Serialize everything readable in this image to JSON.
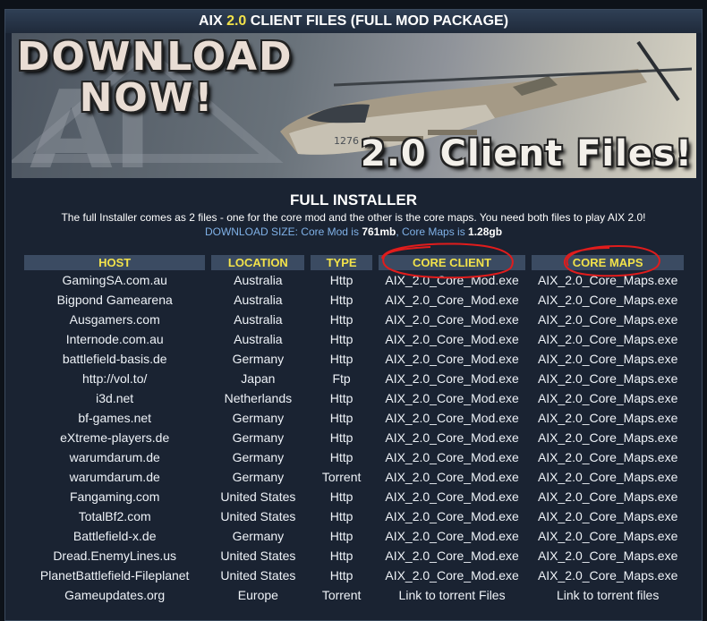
{
  "title": {
    "prefix": "AIX ",
    "version": "2.0",
    "suffix": " CLIENT FILES (FULL MOD PACKAGE)"
  },
  "banner": {
    "line1": "DOWNLOAD",
    "line2": "NOW!",
    "tagline": "2.0 Client Files!",
    "logo_text": "AI",
    "heli_number": "1276"
  },
  "installer": {
    "heading": "FULL INSTALLER",
    "description": "The full Installer comes as 2 files - one for the core mod and the other is the core maps. You need both files to play AIX 2.0!",
    "size_prefix": "DOWNLOAD SIZE: Core Mod is ",
    "core_mod_size": "761mb",
    "size_mid": ", Core Maps is ",
    "core_maps_size": "1.28gb"
  },
  "table": {
    "headers": [
      "HOST",
      "LOCATION",
      "TYPE",
      "CORE CLIENT",
      "CORE MAPS"
    ],
    "rows": [
      [
        "GamingSA.com.au",
        "Australia",
        "Http",
        "AIX_2.0_Core_Mod.exe",
        "AIX_2.0_Core_Maps.exe"
      ],
      [
        "Bigpond Gamearena",
        "Australia",
        "Http",
        "AIX_2.0_Core_Mod.exe",
        "AIX_2.0_Core_Maps.exe"
      ],
      [
        "Ausgamers.com",
        "Australia",
        "Http",
        "AIX_2.0_Core_Mod.exe",
        "AIX_2.0_Core_Maps.exe"
      ],
      [
        "Internode.com.au",
        "Australia",
        "Http",
        "AIX_2.0_Core_Mod.exe",
        "AIX_2.0_Core_Maps.exe"
      ],
      [
        "battlefield-basis.de",
        "Germany",
        "Http",
        "AIX_2.0_Core_Mod.exe",
        "AIX_2.0_Core_Maps.exe"
      ],
      [
        "http://vol.to/",
        "Japan",
        "Ftp",
        "AIX_2.0_Core_Mod.exe",
        "AIX_2.0_Core_Maps.exe"
      ],
      [
        "i3d.net",
        "Netherlands",
        "Http",
        "AIX_2.0_Core_Mod.exe",
        "AIX_2.0_Core_Maps.exe"
      ],
      [
        "bf-games.net",
        "Germany",
        "Http",
        "AIX_2.0_Core_Mod.exe",
        "AIX_2.0_Core_Maps.exe"
      ],
      [
        "eXtreme-players.de",
        "Germany",
        "Http",
        "AIX_2.0_Core_Mod.exe",
        "AIX_2.0_Core_Maps.exe"
      ],
      [
        "warumdarum.de",
        "Germany",
        "Http",
        "AIX_2.0_Core_Mod.exe",
        "AIX_2.0_Core_Maps.exe"
      ],
      [
        "warumdarum.de",
        "Germany",
        "Torrent",
        "AIX_2.0_Core_Mod.exe",
        "AIX_2.0_Core_Maps.exe"
      ],
      [
        "Fangaming.com",
        "United States",
        "Http",
        "AIX_2.0_Core_Mod.exe",
        "AIX_2.0_Core_Maps.exe"
      ],
      [
        "TotalBf2.com",
        "United States",
        "Http",
        "AIX_2.0_Core_Mod.exe",
        "AIX_2.0_Core_Maps.exe"
      ],
      [
        "Battlefield-x.de",
        "Germany",
        "Http",
        "AIX_2.0_Core_Mod.exe",
        "AIX_2.0_Core_Maps.exe"
      ],
      [
        "Dread.EnemyLines.us",
        "United States",
        "Http",
        "AIX_2.0_Core_Mod.exe",
        "AIX_2.0_Core_Maps.exe"
      ],
      [
        "PlanetBattlefield-Fileplanet",
        "United States",
        "Http",
        "AIX_2.0_Core_Mod.exe",
        "AIX_2.0_Core_Maps.exe"
      ],
      [
        "Gameupdates.org",
        "Europe",
        "Torrent",
        "Link to torrent Files",
        "Link to torrent files"
      ]
    ]
  },
  "colors": {
    "background": "#1a2332",
    "header_bg": "#3b4b62",
    "header_text": "#f2e24a",
    "accent_blue": "#7fb0e6",
    "annotation_red": "#e01c1c"
  }
}
